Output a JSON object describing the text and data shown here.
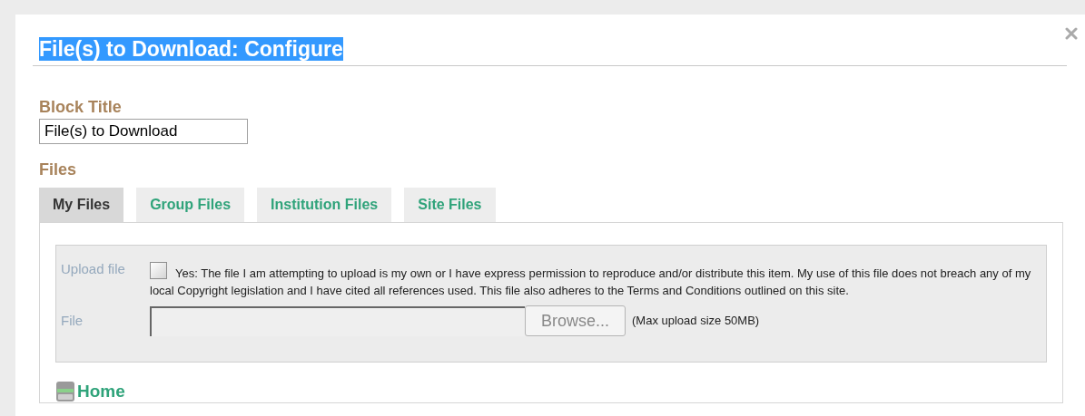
{
  "dialog": {
    "title": "File(s) to Download: Configure",
    "title_selected": true
  },
  "block_title": {
    "label": "Block Title",
    "value": "File(s) to Download"
  },
  "files": {
    "label": "Files",
    "tabs": [
      {
        "label": "My Files",
        "selected": true
      },
      {
        "label": "Group Files",
        "selected": false
      },
      {
        "label": "Institution Files",
        "selected": false
      },
      {
        "label": "Site Files",
        "selected": false
      }
    ],
    "upload": {
      "label": "Upload file",
      "checked": false,
      "agreement": "Yes: The file I am attempting to upload is my own or I have express permission to reproduce and/or distribute this item. My use of this file does not breach any of my local Copyright legislation and I have cited all references used. This file also adheres to the Terms and Conditions outlined on this site."
    },
    "file": {
      "label": "File",
      "button": "Browse...",
      "note": "(Max upload size 50MB)"
    },
    "folder": {
      "label": "Home"
    }
  }
}
